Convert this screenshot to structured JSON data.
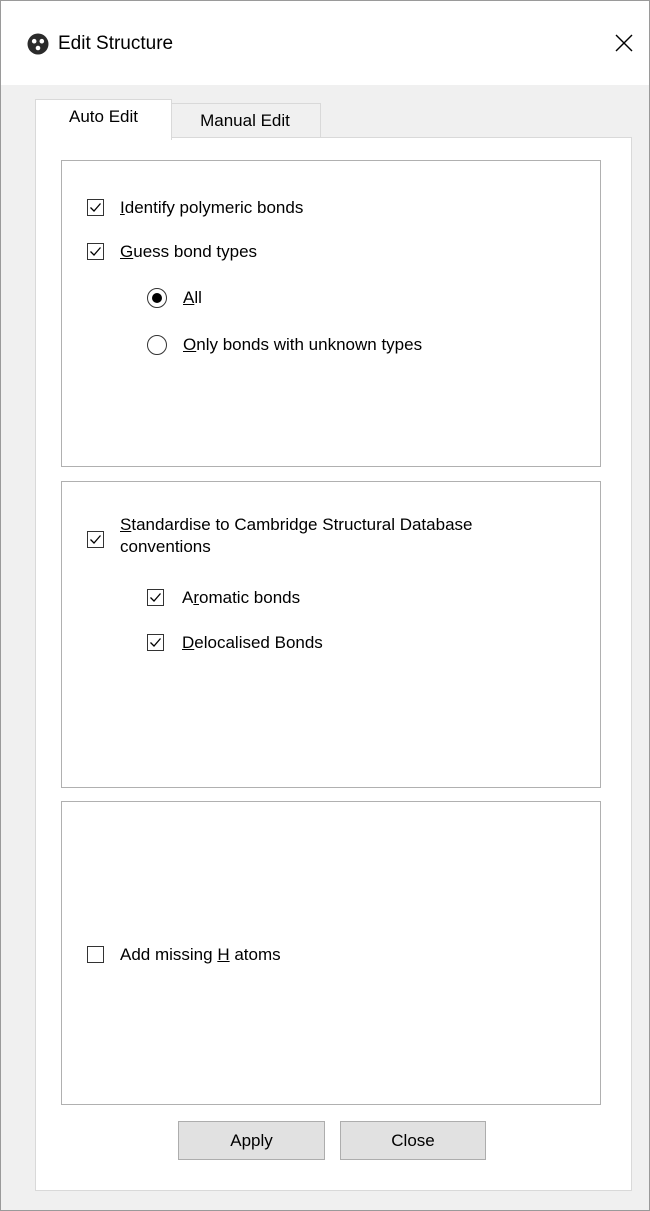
{
  "window": {
    "title": "Edit Structure",
    "icon": "cambridge-logo-icon",
    "close_icon": "close-icon"
  },
  "tabs": [
    {
      "label": "Auto Edit",
      "active": true
    },
    {
      "label": "Manual Edit",
      "active": false
    }
  ],
  "group1": {
    "identify_polymeric": {
      "label_u": "I",
      "label_rest": "dentify polymeric bonds",
      "checked": true
    },
    "guess_bond_types": {
      "label_u": "G",
      "label_rest": "uess bond types",
      "checked": true
    },
    "radio_all": {
      "label_u": "A",
      "label_rest": "ll",
      "selected": true
    },
    "radio_unknown": {
      "label_u": "O",
      "label_rest": "nly bonds with unknown types",
      "selected": false
    }
  },
  "group2": {
    "standardise": {
      "label_u": "S",
      "label_line1_rest": "tandardise to Cambridge Structural Database",
      "label_line2": "conventions",
      "checked": true
    },
    "aromatic": {
      "label_pre": "A",
      "label_u": "r",
      "label_rest": "omatic bonds",
      "checked": true
    },
    "delocalised": {
      "label_u": "D",
      "label_rest": "elocalised Bonds",
      "checked": true
    }
  },
  "group3": {
    "add_missing_h": {
      "label_pre": "Add missing ",
      "label_u": "H",
      "label_rest": " atoms",
      "checked": false
    }
  },
  "buttons": {
    "apply": "Apply",
    "close": "Close"
  }
}
